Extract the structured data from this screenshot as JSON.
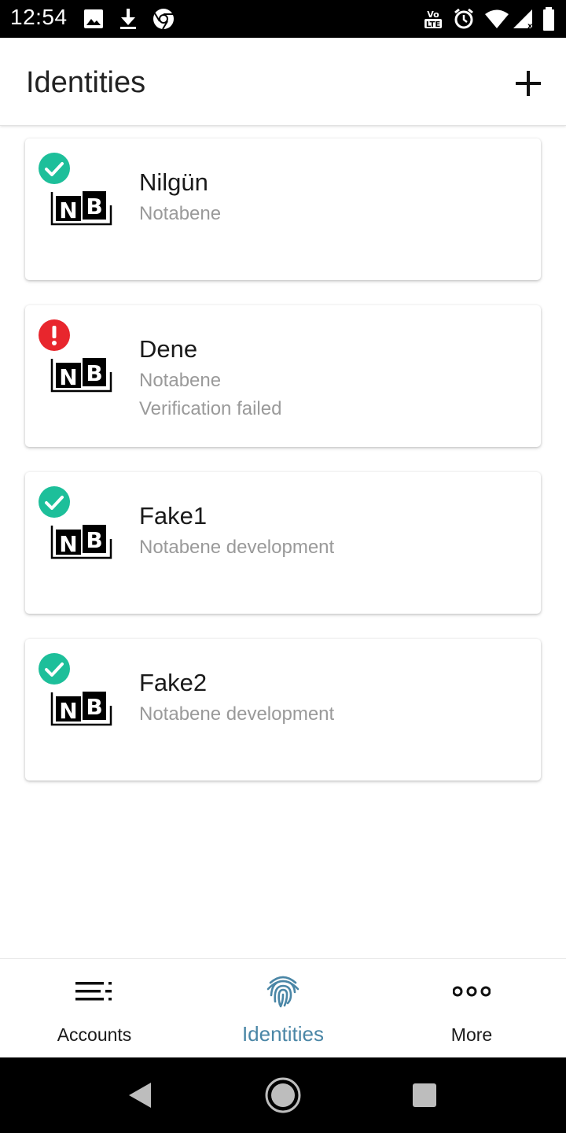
{
  "status_bar": {
    "time": "12:54",
    "left_icons": [
      "image-icon",
      "download-icon",
      "chrome-icon"
    ],
    "right_icons": [
      "volte-icon",
      "alarm-icon",
      "wifi-icon",
      "signal-icon",
      "battery-icon"
    ]
  },
  "header": {
    "title": "Identities",
    "add_icon": "plus-icon"
  },
  "identities": [
    {
      "name": "Nilgün",
      "issuer": "Notabene",
      "status": "verified",
      "status_text": ""
    },
    {
      "name": "Dene",
      "issuer": "Notabene",
      "status": "error",
      "status_text": "Verification failed"
    },
    {
      "name": "Fake1",
      "issuer": "Notabene development",
      "status": "verified",
      "status_text": ""
    },
    {
      "name": "Fake2",
      "issuer": "Notabene development",
      "status": "verified",
      "status_text": ""
    }
  ],
  "bottom_nav": {
    "items": [
      {
        "label": "Accounts",
        "icon": "list-icon",
        "active": false
      },
      {
        "label": "Identities",
        "icon": "fingerprint-icon",
        "active": true
      },
      {
        "label": "More",
        "icon": "more-icon",
        "active": false
      }
    ]
  },
  "colors": {
    "verified": "#1dbf9a",
    "error": "#e8262d",
    "active_nav": "#4a86a6"
  }
}
